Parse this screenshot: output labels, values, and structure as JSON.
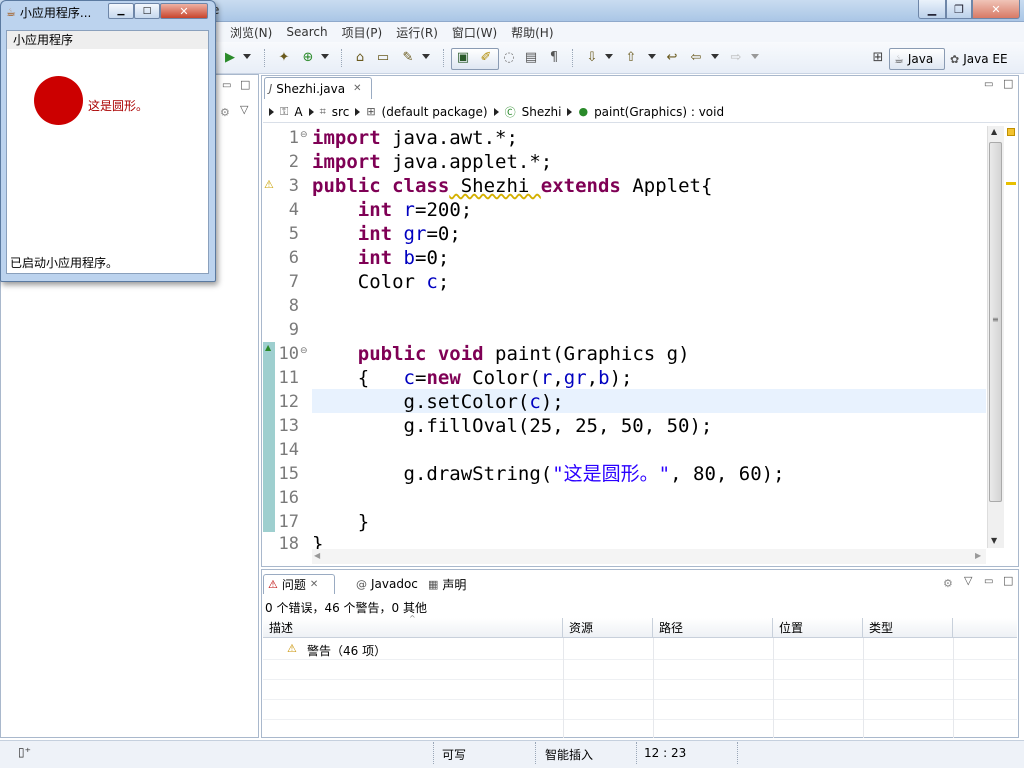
{
  "window": {
    "title": "e"
  },
  "menubar": {
    "items": [
      "浏览(N)",
      "Search",
      "项目(P)",
      "运行(R)",
      "窗口(W)",
      "帮助(H)"
    ]
  },
  "perspectives": {
    "java": "Java",
    "javaee": "Java EE"
  },
  "editor": {
    "tab_label": "Shezhi.java",
    "breadcrumb": [
      "A",
      "src",
      "(default package)",
      "Shezhi",
      "paint(Graphics) : void"
    ],
    "line_numbers": [
      "1",
      "2",
      "3",
      "4",
      "5",
      "6",
      "7",
      "8",
      "9",
      "10",
      "11",
      "12",
      "13",
      "14",
      "15",
      "16",
      "17",
      "18"
    ],
    "code": {
      "l1_kw": "import",
      "l1_rest": " java.awt.*;",
      "l2_kw": "import",
      "l2_rest": " java.applet.*;",
      "l3_kw1": "public class",
      "l3_mid": " Shezhi ",
      "l3_kw2": "extends",
      "l3_rest": " Applet{",
      "l4_kw": "int",
      "l4_var": "r",
      "l4_rest": "=200;",
      "l5_kw": "int",
      "l5_var": "gr",
      "l5_rest": "=0;",
      "l6_kw": "int",
      "l6_var": "b",
      "l6_rest": "=0;",
      "l7_type": "Color",
      "l7_var": "c",
      "l7_rest": ";",
      "l10_kw": "public void",
      "l10_rest": " paint(Graphics g)",
      "l11_open": "{",
      "l11_var1": "c",
      "l11_eq": "=",
      "l11_kw": "new",
      "l11_mid": " Color(",
      "l11_v1": "r",
      "l11_c1": ",",
      "l11_v2": "gr",
      "l11_c2": ",",
      "l11_v3": "b",
      "l11_end": ");",
      "l12_pre": "g.setColor(",
      "l12_var": "c",
      "l12_end": ");",
      "l13": "g.fillOval(25, 25, 50, 50);",
      "l15_pre": "g.drawString(",
      "l15_str": "\"这是圆形。\"",
      "l15_end": ", 80, 60);",
      "l17": "}",
      "l18": "}"
    }
  },
  "problems": {
    "tabs": [
      "问题",
      "Javadoc",
      "声明"
    ],
    "summary": "0 个错误，46 个警告，0 其他",
    "columns": [
      "描述",
      "资源",
      "路径",
      "位置",
      "类型"
    ],
    "rows": [
      {
        "label": "警告（46 项）"
      }
    ]
  },
  "statusbar": {
    "writable": "可写",
    "insert_mode": "智能插入",
    "position": "12 : 23"
  },
  "applet": {
    "title": "小应用程序...",
    "menu_label": "小应用程序",
    "drawn_text": "这是圆形。",
    "status": "已启动小应用程序。",
    "circle_color": "#cc0000"
  }
}
